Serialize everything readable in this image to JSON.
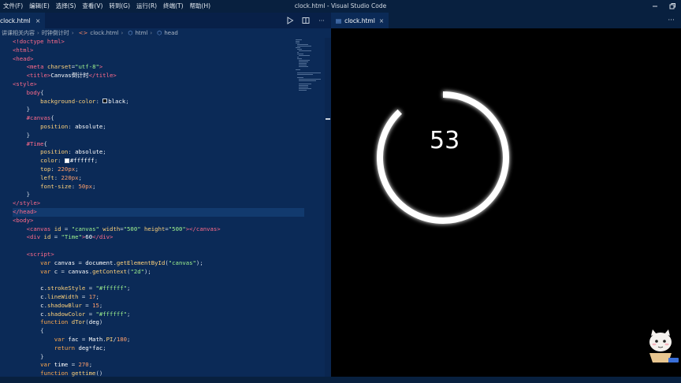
{
  "menu": [
    "文件(F)",
    "编辑(E)",
    "选择(S)",
    "查看(V)",
    "转到(G)",
    "运行(R)",
    "终端(T)",
    "帮助(H)"
  ],
  "window_title": "clock.html - Visual Studio Code",
  "left_tab": {
    "label": "clock.html",
    "close": "×"
  },
  "breadcrumb": [
    "讲课相关内容",
    "时钟倒计时",
    "clock.html",
    "html",
    "head"
  ],
  "right_tab": {
    "label": "clock.html",
    "close": "×",
    "more": "···"
  },
  "left_more": "···",
  "preview": {
    "timer_value": "53",
    "progress_fraction": 0.88
  },
  "colors": {
    "accent": "#ff6b8a",
    "editor_bg": "#0b2a57",
    "preview_bg": "#000000"
  },
  "code_lines": [
    [
      [
        "t-tag",
        "<!doctype html>"
      ]
    ],
    [
      [
        "t-tag",
        "<html>"
      ]
    ],
    [
      [
        "t-tag",
        "<head>"
      ]
    ],
    [
      [
        "t-punc",
        "    "
      ],
      [
        "t-tag",
        "<meta "
      ],
      [
        "t-attr",
        "charset"
      ],
      [
        "t-punc",
        "="
      ],
      [
        "t-str",
        "\"utf-8\""
      ],
      [
        "t-tag",
        ">"
      ]
    ],
    [
      [
        "t-punc",
        "    "
      ],
      [
        "t-tag",
        "<title>"
      ],
      [
        "t-text",
        "Canvas倒计时"
      ],
      [
        "t-tag",
        "</title>"
      ]
    ],
    [
      [
        "t-tag",
        "<style>"
      ]
    ],
    [
      [
        "t-punc",
        "    "
      ],
      [
        "t-sel",
        "body"
      ],
      [
        "t-punc",
        "{"
      ]
    ],
    [
      [
        "t-punc",
        "        "
      ],
      [
        "t-prop",
        "background-color"
      ],
      [
        "t-punc",
        ": "
      ],
      [
        "swatch",
        "#000000"
      ],
      [
        "t-val",
        "black"
      ],
      [
        "t-punc",
        ";"
      ]
    ],
    [
      [
        "t-punc",
        "    }"
      ]
    ],
    [
      [
        "t-punc",
        "    "
      ],
      [
        "t-sel",
        "#canvas"
      ],
      [
        "t-punc",
        "{"
      ]
    ],
    [
      [
        "t-punc",
        "        "
      ],
      [
        "t-prop",
        "position"
      ],
      [
        "t-punc",
        ": "
      ],
      [
        "t-val",
        "absolute"
      ],
      [
        "t-punc",
        ";"
      ]
    ],
    [
      [
        "t-punc",
        "    }"
      ]
    ],
    [
      [
        "t-punc",
        "    "
      ],
      [
        "t-sel",
        "#Time"
      ],
      [
        "t-punc",
        "{"
      ]
    ],
    [
      [
        "t-punc",
        "        "
      ],
      [
        "t-prop",
        "position"
      ],
      [
        "t-punc",
        ": "
      ],
      [
        "t-val",
        "absolute"
      ],
      [
        "t-punc",
        ";"
      ]
    ],
    [
      [
        "t-punc",
        "        "
      ],
      [
        "t-prop",
        "color"
      ],
      [
        "t-punc",
        ": "
      ],
      [
        "swatch",
        "#ffffff"
      ],
      [
        "t-val",
        "#ffffff"
      ],
      [
        "t-punc",
        ";"
      ]
    ],
    [
      [
        "t-punc",
        "        "
      ],
      [
        "t-prop",
        "top"
      ],
      [
        "t-punc",
        ": "
      ],
      [
        "t-num",
        "220px"
      ],
      [
        "t-punc",
        ";"
      ]
    ],
    [
      [
        "t-punc",
        "        "
      ],
      [
        "t-prop",
        "left"
      ],
      [
        "t-punc",
        ": "
      ],
      [
        "t-num",
        "220px"
      ],
      [
        "t-punc",
        ";"
      ]
    ],
    [
      [
        "t-punc",
        "        "
      ],
      [
        "t-prop",
        "font-size"
      ],
      [
        "t-punc",
        ": "
      ],
      [
        "t-num",
        "50px"
      ],
      [
        "t-punc",
        ";"
      ]
    ],
    [
      [
        "t-punc",
        "    }"
      ]
    ],
    [
      [
        "t-tag",
        "</style>"
      ]
    ],
    [
      [
        "t-tag",
        "</head>"
      ]
    ],
    [
      [
        "t-tag",
        "<body>"
      ]
    ],
    [
      [
        "t-punc",
        "    "
      ],
      [
        "t-tag",
        "<canvas "
      ],
      [
        "t-attr",
        "id"
      ],
      [
        "t-punc",
        " = "
      ],
      [
        "t-str",
        "\"canvas\""
      ],
      [
        "t-attr",
        " width"
      ],
      [
        "t-punc",
        "="
      ],
      [
        "t-str",
        "\"500\""
      ],
      [
        "t-attr",
        " height"
      ],
      [
        "t-punc",
        "="
      ],
      [
        "t-str",
        "\"500\""
      ],
      [
        "t-tag",
        "></canvas>"
      ]
    ],
    [
      [
        "t-punc",
        "    "
      ],
      [
        "t-tag",
        "<div "
      ],
      [
        "t-attr",
        "id"
      ],
      [
        "t-punc",
        " = "
      ],
      [
        "t-str",
        "\"Time\""
      ],
      [
        "t-tag",
        ">"
      ],
      [
        "t-text",
        "60"
      ],
      [
        "t-tag",
        "</div>"
      ]
    ],
    [],
    [
      [
        "t-punc",
        "    "
      ],
      [
        "t-tag",
        "<script>"
      ]
    ],
    [
      [
        "t-punc",
        "        "
      ],
      [
        "t-kw",
        "var "
      ],
      [
        "t-var",
        "canvas"
      ],
      [
        "t-punc",
        " = "
      ],
      [
        "t-var",
        "document"
      ],
      [
        "t-punc",
        "."
      ],
      [
        "t-fn",
        "getElementById"
      ],
      [
        "t-punc",
        "("
      ],
      [
        "t-str",
        "\"canvas\""
      ],
      [
        "t-punc",
        ");"
      ]
    ],
    [
      [
        "t-punc",
        "        "
      ],
      [
        "t-kw",
        "var "
      ],
      [
        "t-var",
        "c"
      ],
      [
        "t-punc",
        " = "
      ],
      [
        "t-var",
        "canvas"
      ],
      [
        "t-punc",
        "."
      ],
      [
        "t-fn",
        "getContext"
      ],
      [
        "t-punc",
        "("
      ],
      [
        "t-str",
        "\"2d\""
      ],
      [
        "t-punc",
        ");"
      ]
    ],
    [],
    [
      [
        "t-punc",
        "        "
      ],
      [
        "t-var",
        "c"
      ],
      [
        "t-punc",
        "."
      ],
      [
        "t-prop",
        "strokeStyle"
      ],
      [
        "t-punc",
        " = "
      ],
      [
        "t-str",
        "\"#ffffff\""
      ],
      [
        "t-punc",
        ";"
      ]
    ],
    [
      [
        "t-punc",
        "        "
      ],
      [
        "t-var",
        "c"
      ],
      [
        "t-punc",
        "."
      ],
      [
        "t-prop",
        "lineWidth"
      ],
      [
        "t-punc",
        " = "
      ],
      [
        "t-num",
        "17"
      ],
      [
        "t-punc",
        ";"
      ]
    ],
    [
      [
        "t-punc",
        "        "
      ],
      [
        "t-var",
        "c"
      ],
      [
        "t-punc",
        "."
      ],
      [
        "t-prop",
        "shadowBlur"
      ],
      [
        "t-punc",
        " = "
      ],
      [
        "t-num",
        "15"
      ],
      [
        "t-punc",
        ";"
      ]
    ],
    [
      [
        "t-punc",
        "        "
      ],
      [
        "t-var",
        "c"
      ],
      [
        "t-punc",
        "."
      ],
      [
        "t-prop",
        "shadowColor"
      ],
      [
        "t-punc",
        " = "
      ],
      [
        "t-str",
        "\"#ffffff\""
      ],
      [
        "t-punc",
        ";"
      ]
    ],
    [
      [
        "t-punc",
        "        "
      ],
      [
        "t-kw",
        "function "
      ],
      [
        "t-fn",
        "dTor"
      ],
      [
        "t-punc",
        "("
      ],
      [
        "t-var",
        "deg"
      ],
      [
        "t-punc",
        ")"
      ]
    ],
    [
      [
        "t-punc",
        "        {"
      ]
    ],
    [
      [
        "t-punc",
        "            "
      ],
      [
        "t-kw",
        "var "
      ],
      [
        "t-var",
        "fac"
      ],
      [
        "t-punc",
        " = "
      ],
      [
        "t-var",
        "Math"
      ],
      [
        "t-punc",
        "."
      ],
      [
        "t-prop",
        "PI"
      ],
      [
        "t-punc",
        "/"
      ],
      [
        "t-num",
        "180"
      ],
      [
        "t-punc",
        ";"
      ]
    ],
    [
      [
        "t-punc",
        "            "
      ],
      [
        "t-kw",
        "return "
      ],
      [
        "t-var",
        "deg"
      ],
      [
        "t-punc",
        "*"
      ],
      [
        "t-var",
        "fac"
      ],
      [
        "t-punc",
        ";"
      ]
    ],
    [
      [
        "t-punc",
        "        }"
      ]
    ],
    [
      [
        "t-punc",
        "        "
      ],
      [
        "t-kw",
        "var "
      ],
      [
        "t-var",
        "time"
      ],
      [
        "t-punc",
        " = "
      ],
      [
        "t-num",
        "270"
      ],
      [
        "t-punc",
        ";"
      ]
    ],
    [
      [
        "t-punc",
        "        "
      ],
      [
        "t-kw",
        "function "
      ],
      [
        "t-fn",
        "gettime"
      ],
      [
        "t-punc",
        "()"
      ]
    ]
  ]
}
